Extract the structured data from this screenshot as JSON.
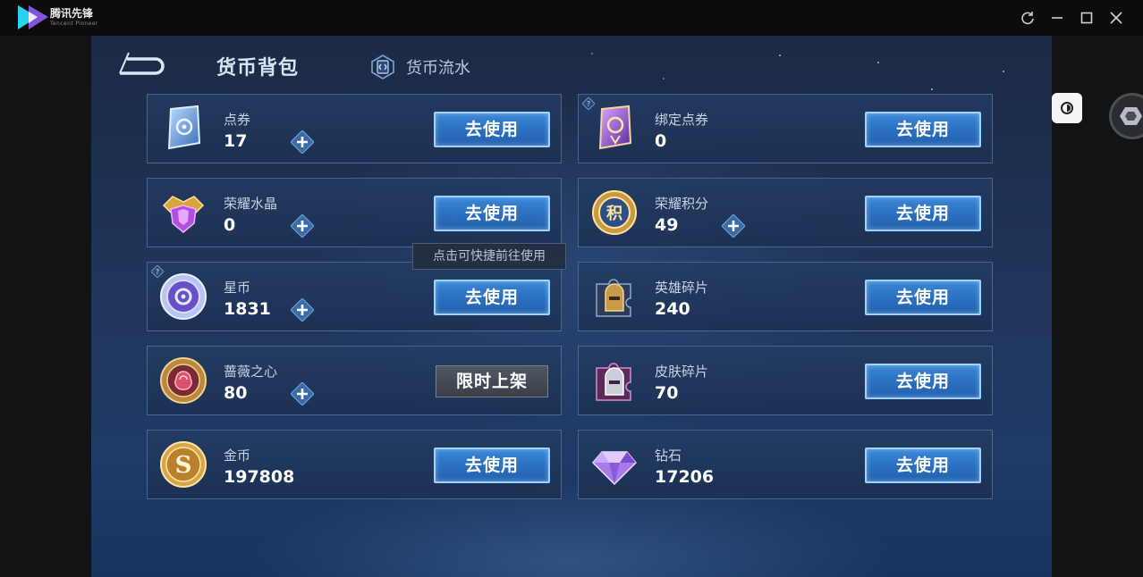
{
  "app": {
    "name": "腾讯先锋",
    "subtitle": "Tencent Pioneer",
    "brand_colors": {
      "logo_cyan": "#27d3f0",
      "logo_purple": "#8e5cf2"
    }
  },
  "header": {
    "title": "货币背包",
    "tab_flow": "货币流水"
  },
  "tooltip": "点击可快捷前往使用",
  "currencies": [
    {
      "name": "点券",
      "amount": "17",
      "icon": "voucher-card-icon",
      "button": "去使用",
      "plus": true,
      "help": false
    },
    {
      "name": "绑定点券",
      "amount": "0",
      "icon": "bound-voucher-icon",
      "button": "去使用",
      "plus": false,
      "help": true
    },
    {
      "name": "荣耀水晶",
      "amount": "0",
      "icon": "glory-crystal-icon",
      "button": "去使用",
      "plus": true,
      "help": false
    },
    {
      "name": "荣耀积分",
      "amount": "49",
      "icon": "glory-points-icon",
      "button": "去使用",
      "plus": true,
      "help": false
    },
    {
      "name": "星币",
      "amount": "1831",
      "icon": "star-coin-icon",
      "button": "去使用",
      "plus": true,
      "help": true
    },
    {
      "name": "英雄碎片",
      "amount": "240",
      "icon": "hero-fragment-icon",
      "button": "去使用",
      "plus": false,
      "help": false
    },
    {
      "name": "蔷薇之心",
      "amount": "80",
      "icon": "rose-heart-icon",
      "button": "限时上架",
      "plus": true,
      "help": false,
      "button_disabled": true
    },
    {
      "name": "皮肤碎片",
      "amount": "70",
      "icon": "skin-fragment-icon",
      "button": "去使用",
      "plus": false,
      "help": false
    },
    {
      "name": "金币",
      "amount": "197808",
      "icon": "gold-coin-icon",
      "button": "去使用",
      "plus": false,
      "help": false
    },
    {
      "name": "钻石",
      "amount": "17206",
      "icon": "diamond-icon",
      "button": "去使用",
      "plus": false,
      "help": false
    }
  ],
  "colors": {
    "use_button": "#2a6fc0",
    "use_button_border": "#9fd1ff",
    "panel_bg": "#20355a",
    "limited_button": "#454c55"
  }
}
